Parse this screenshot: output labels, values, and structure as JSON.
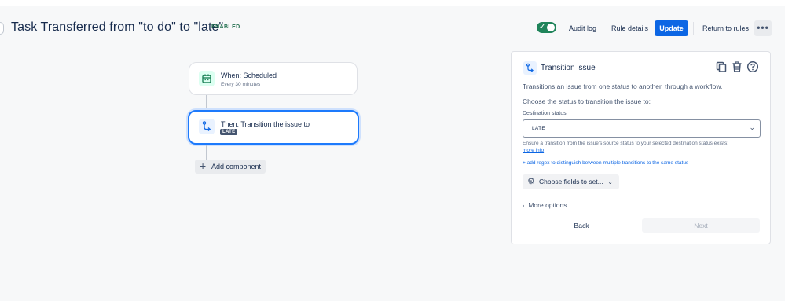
{
  "header": {
    "title": "Task Transferred from \"to do\" to \"late\"",
    "status_badge": "ENABLED",
    "audit_log": "Audit log",
    "rule_details": "Rule details",
    "update": "Update",
    "return_to_rules": "Return to rules",
    "more": "•••",
    "toggle_state": "on"
  },
  "canvas": {
    "trigger": {
      "title": "When: Scheduled",
      "subtitle": "Every 30 minutes",
      "icon": "calendar-icon"
    },
    "action": {
      "title": "Then: Transition the issue to",
      "tag": "LATE",
      "icon": "transition-icon"
    },
    "add_component": "Add component"
  },
  "panel": {
    "title": "Transition issue",
    "description": "Transitions an issue from one status to another, through a workflow.",
    "choose_label": "Choose the status to transition the issue to:",
    "destination_label": "Destination status",
    "destination_value": "LATE",
    "hint": "Ensure a transition from the issue's source status to your selected destination status exists;",
    "hint_link": "more info",
    "regex_link": "+ add regex to distinguish between multiple transitions to the same status",
    "choose_fields": "Choose fields to set...",
    "more_options": "More options",
    "back": "Back",
    "next": "Next"
  },
  "colors": {
    "primary": "#0c66e4",
    "toggle_on": "#1f845a",
    "selected_border": "#1d7afc",
    "tag_bg": "#44546f"
  }
}
